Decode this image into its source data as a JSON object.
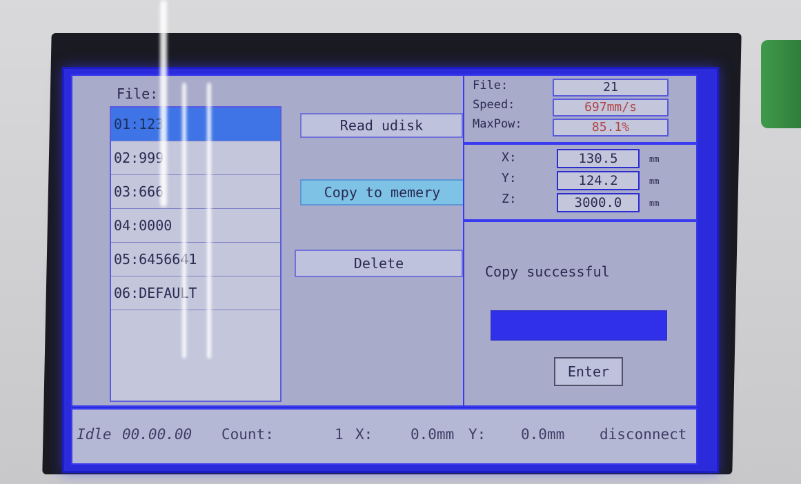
{
  "file_panel": {
    "label": "File:",
    "files": [
      "01:123",
      "02:999",
      "03:666",
      "04:0000",
      "05:6456641",
      "06:DEFAULT"
    ],
    "selected_index": 0
  },
  "actions": {
    "read_udisk": "Read udisk",
    "copy_to_memory": "Copy to memery",
    "delete": "Delete"
  },
  "info": {
    "file_label": "File:",
    "file_value": "21",
    "speed_label": "Speed:",
    "speed_value": "697mm/s",
    "maxpow_label": "MaxPow:",
    "maxpow_value": "85.1%"
  },
  "coords": {
    "x_label": "X:",
    "x_value": "130.5",
    "y_label": "Y:",
    "y_value": "124.2",
    "z_label": "Z:",
    "z_value": "3000.0",
    "unit": "mm"
  },
  "dialog": {
    "message": "Copy successful",
    "progress": 1.0,
    "enter_label": "Enter"
  },
  "status_bar": {
    "state": "Idle",
    "time": "00.00.00",
    "count_label": "Count:",
    "count_value": "1",
    "x_label": "X:",
    "x_value": "0.0mm",
    "y_label": "Y:",
    "y_value": "0.0mm",
    "connection": "disconnect"
  },
  "colors": {
    "screen_border": "#2b2bdc",
    "panel_bg": "#a8abc9",
    "selected_row": "#3f74e6",
    "active_button": "#7ec2e6",
    "progress_fill": "#3030ea"
  }
}
